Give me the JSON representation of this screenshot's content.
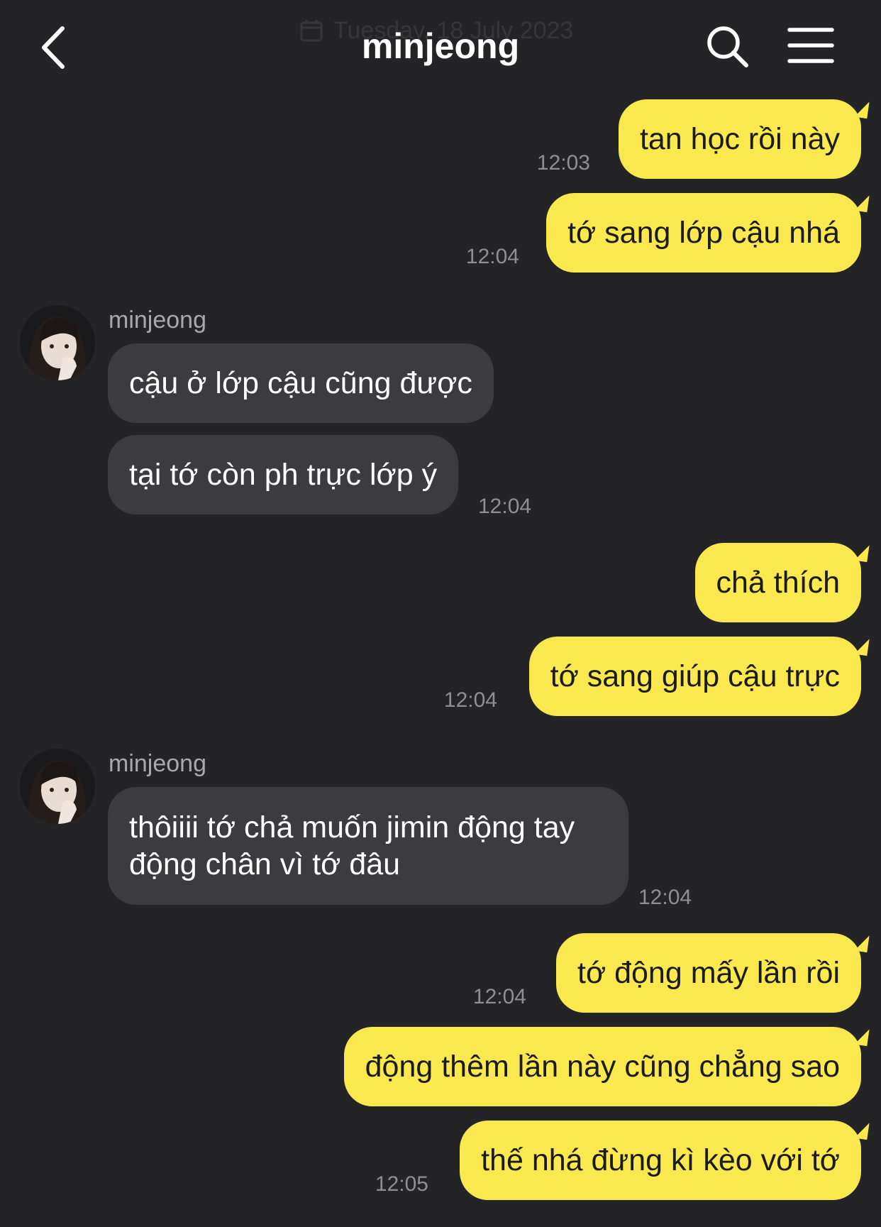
{
  "header": {
    "date": "Tuesday, 18 July 2023",
    "title": "minjeong"
  },
  "messages": [
    {
      "from": "me",
      "text": "tan học rồi này",
      "time": "12:03"
    },
    {
      "from": "me",
      "text": "tớ sang lớp cậu nhá",
      "time": "12:04"
    },
    {
      "from": "them",
      "sender": "minjeong",
      "text": "cậu ở lớp cậu cũng được"
    },
    {
      "from": "them",
      "text": "tại tớ còn ph trực lớp ý",
      "time": "12:04"
    },
    {
      "from": "me",
      "text": "chả thích"
    },
    {
      "from": "me",
      "text": "tớ sang giúp cậu trực",
      "time": "12:04"
    },
    {
      "from": "them",
      "sender": "minjeong",
      "text": "thôiiii tớ chả muốn jimin động tay động chân vì tớ đâu",
      "time": "12:04"
    },
    {
      "from": "me",
      "text": "tớ động mấy lần rồi",
      "time": "12:04"
    },
    {
      "from": "me",
      "text": "động thêm lần này cũng chẳng sao"
    },
    {
      "from": "me",
      "text": "thế nhá đừng kì kèo với tớ",
      "time": "12:05"
    }
  ],
  "colors": {
    "background": "#242427",
    "my_bubble": "#fae84f",
    "their_bubble": "#3c3c40",
    "timestamp": "#8e8e93"
  },
  "icons": {
    "back": "chevron-left-icon",
    "search": "search-icon",
    "menu": "hamburger-menu-icon",
    "calendar": "calendar-icon"
  }
}
